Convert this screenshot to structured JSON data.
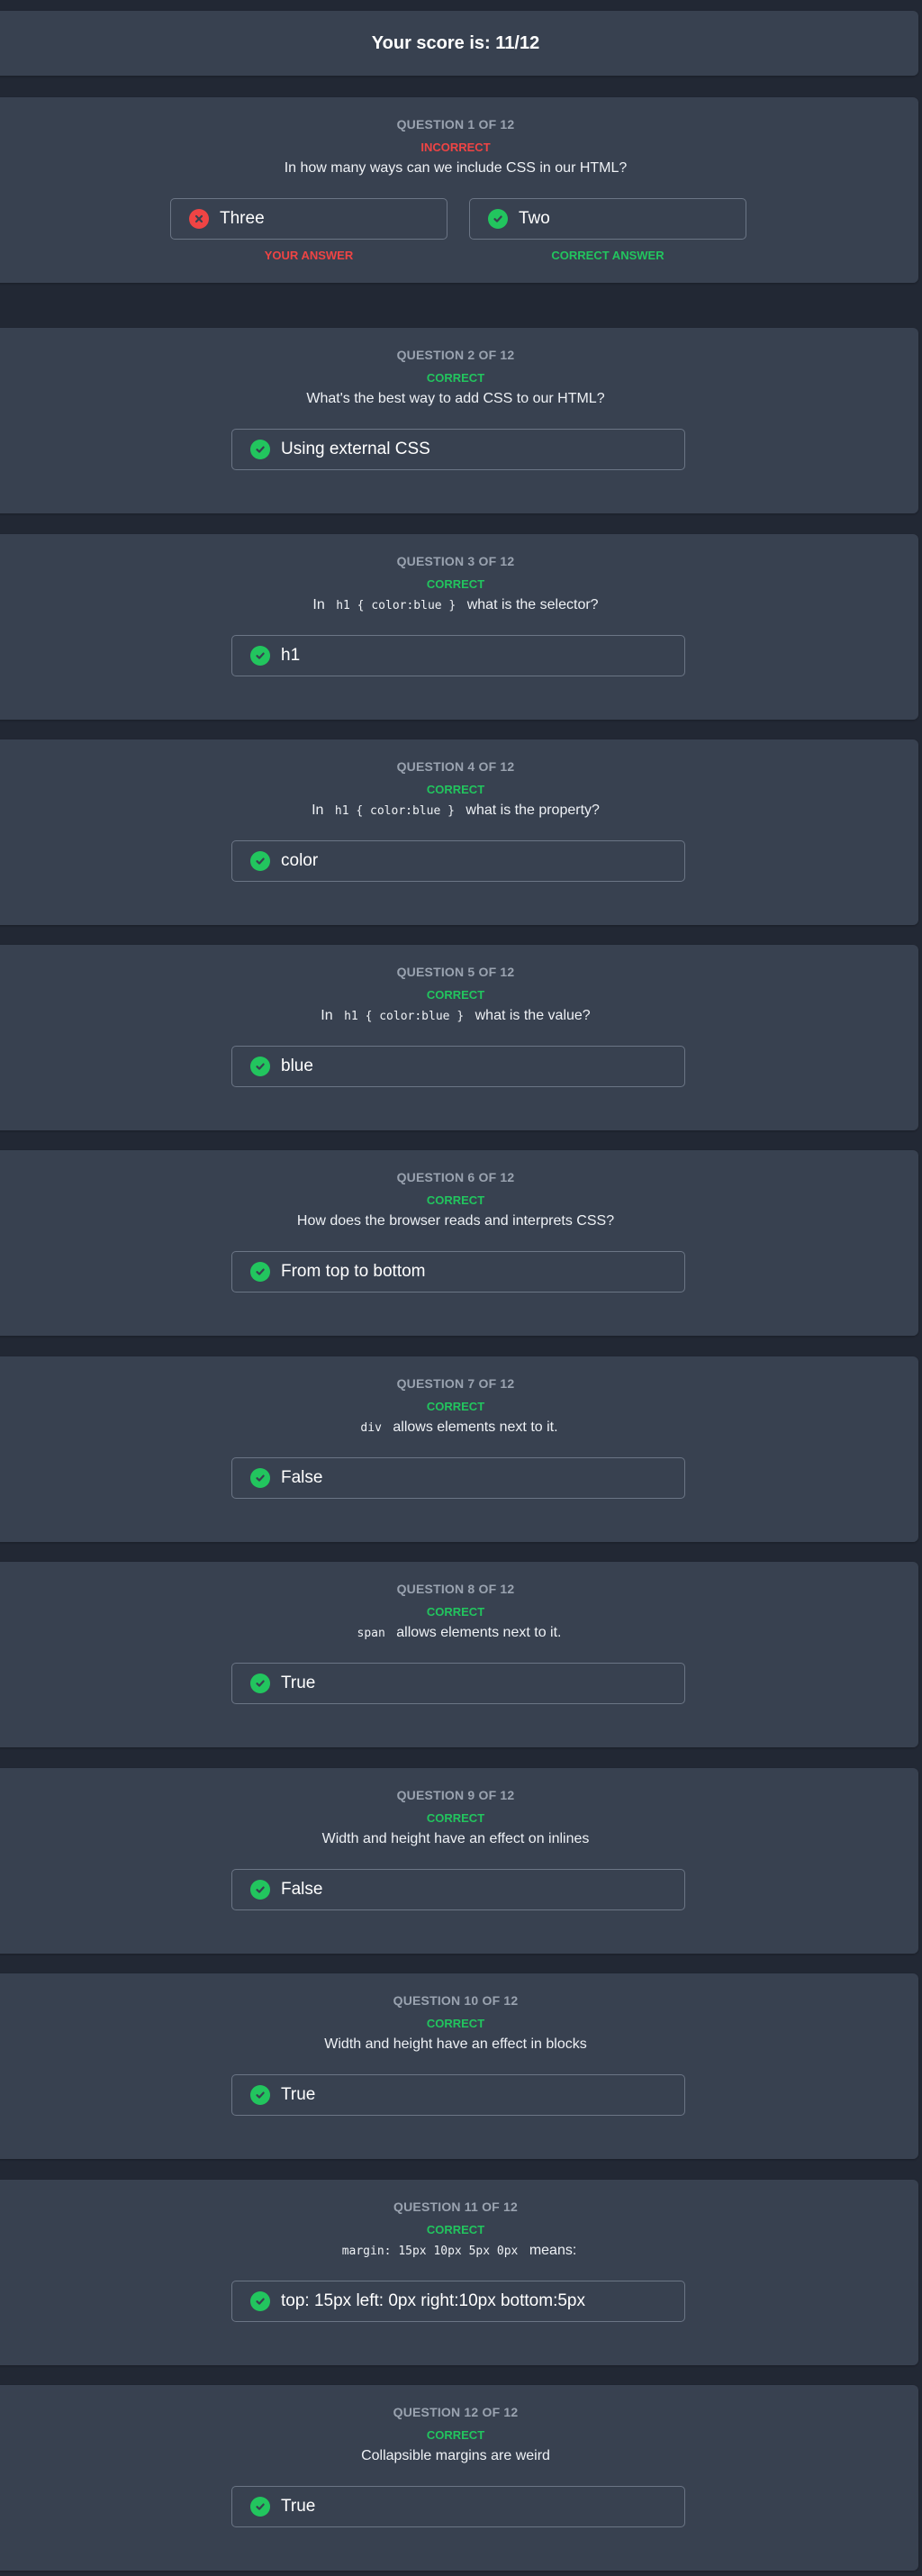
{
  "score": {
    "label": "Your score is: 11/12"
  },
  "questions": [
    {
      "number": "QUESTION 1 OF 12",
      "status": "INCORRECT",
      "text": "In how many ways can we include CSS in our HTML?",
      "your_answer": "Three",
      "correct_answer": "Two",
      "your_answer_caption": "YOUR ANSWER",
      "correct_answer_caption": "CORRECT ANSWER"
    },
    {
      "number": "QUESTION 2 OF 12",
      "status": "CORRECT",
      "text": "What's the best way to add CSS to our HTML?",
      "answer": "Using external CSS"
    },
    {
      "number": "QUESTION 3 OF 12",
      "status": "CORRECT",
      "text_before": "In",
      "code": "h1 { color:blue }",
      "text_after": "what is the selector?",
      "answer": "h1"
    },
    {
      "number": "QUESTION 4 OF 12",
      "status": "CORRECT",
      "text_before": "In",
      "code": "h1 { color:blue }",
      "text_after": "what is the property?",
      "answer": "color"
    },
    {
      "number": "QUESTION 5 OF 12",
      "status": "CORRECT",
      "text_before": "In",
      "code": "h1 { color:blue }",
      "text_after": "what is the value?",
      "answer": "blue"
    },
    {
      "number": "QUESTION 6 OF 12",
      "status": "CORRECT",
      "text": "How does the browser reads and interprets CSS?",
      "answer": "From top to bottom"
    },
    {
      "number": "QUESTION 7 OF 12",
      "status": "CORRECT",
      "code": "div",
      "text_after": "allows elements next to it.",
      "answer": "False"
    },
    {
      "number": "QUESTION 8 OF 12",
      "status": "CORRECT",
      "code": "span",
      "text_after": "allows elements next to it.",
      "answer": "True"
    },
    {
      "number": "QUESTION 9 OF 12",
      "status": "CORRECT",
      "text": "Width and height have an effect on inlines",
      "answer": "False"
    },
    {
      "number": "QUESTION 10 OF 12",
      "status": "CORRECT",
      "text": "Width and height have an effect in blocks",
      "answer": "True"
    },
    {
      "number": "QUESTION 11 OF 12",
      "status": "CORRECT",
      "code": "margin: 15px 10px 5px 0px",
      "text_after": "means:",
      "answer": "top: 15px left: 0px right:10px bottom:5px"
    },
    {
      "number": "QUESTION 12 OF 12",
      "status": "CORRECT",
      "text": "Collapsible margins are weird",
      "answer": "True"
    }
  ],
  "icons": {
    "correct": "check-circle-icon",
    "incorrect": "x-circle-icon"
  },
  "colors": {
    "background": "#222834",
    "panel": "#384150",
    "correct": "#22c55e",
    "incorrect": "#ef4444",
    "muted": "#9aa3b0"
  }
}
